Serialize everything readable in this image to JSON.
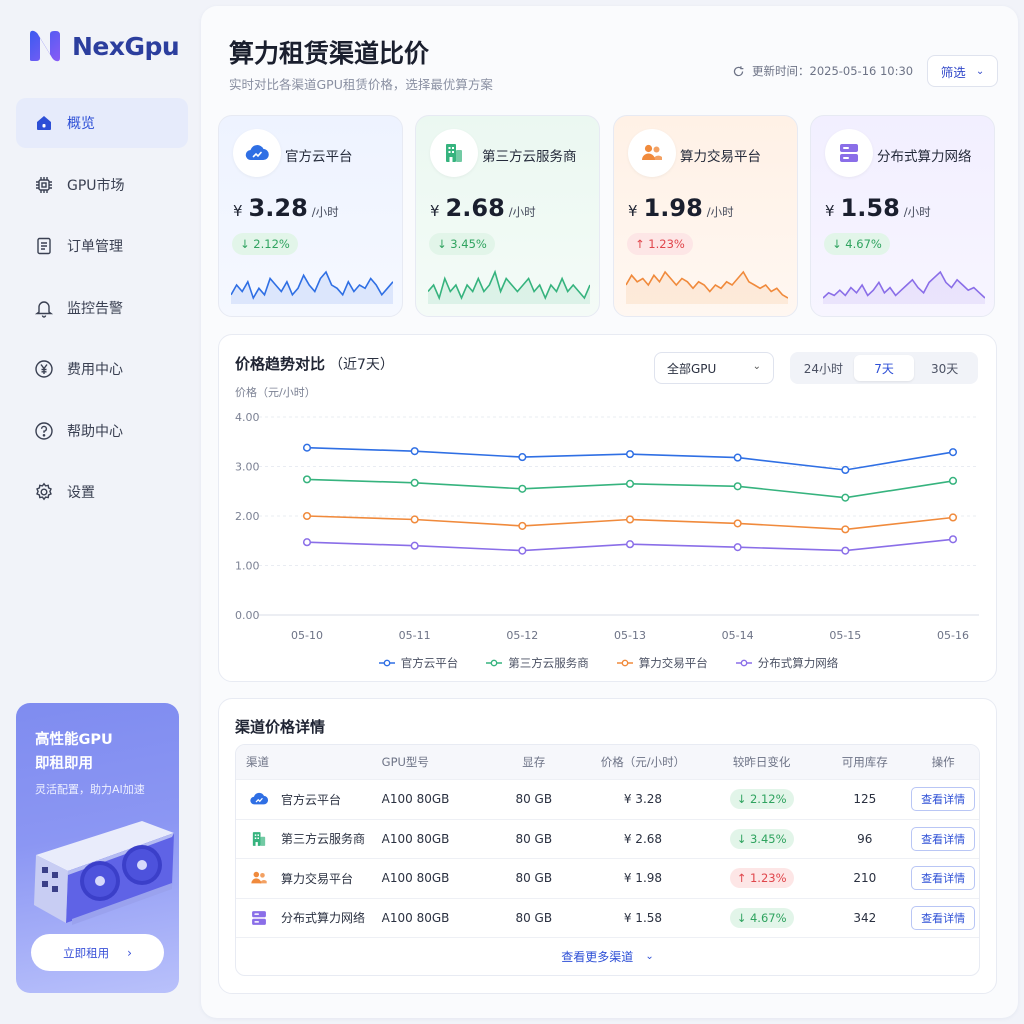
{
  "app": {
    "name": "NexGpu"
  },
  "nav": [
    {
      "label": "概览",
      "icon": "home-icon",
      "active": true
    },
    {
      "label": "GPU市场",
      "icon": "chip-icon"
    },
    {
      "label": "订单管理",
      "icon": "document-icon"
    },
    {
      "label": "监控告警",
      "icon": "bell-icon"
    },
    {
      "label": "费用中心",
      "icon": "yen-icon"
    },
    {
      "label": "帮助中心",
      "icon": "help-icon"
    },
    {
      "label": "设置",
      "icon": "gear-icon"
    }
  ],
  "promo": {
    "title_line1": "高性能GPU",
    "title_line2": "即租即用",
    "subtitle": "灵活配置，助力AI加速",
    "button": "立即租用"
  },
  "header": {
    "title": "算力租赁渠道比价",
    "subtitle": "实时对比各渠道GPU租赁价格，选择最优算方案",
    "update": "更新时间：2025-05-16 10:30",
    "filter": "筛选"
  },
  "cards": [
    {
      "name": "官方云平台",
      "currency": "¥",
      "price": "3.28",
      "unit": "/小时",
      "change": "↓ 2.12%",
      "dir": "down",
      "color": "#2f6fe4",
      "icon": "cloud-icon",
      "spark": [
        9,
        12,
        10,
        13,
        8,
        11,
        9,
        14,
        12,
        10,
        13,
        9,
        11,
        15,
        12,
        10,
        14,
        16,
        12,
        11,
        9,
        13,
        10,
        12,
        11,
        14,
        12,
        9,
        11,
        13
      ]
    },
    {
      "name": "第三方云服务商",
      "currency": "¥",
      "price": "2.68",
      "unit": "/小时",
      "change": "↓ 3.45%",
      "dir": "down",
      "color": "#36b37e",
      "icon": "building-icon",
      "spark": [
        11,
        12,
        10,
        13,
        11,
        12,
        10,
        12,
        11,
        13,
        11,
        12,
        14,
        11,
        13,
        12,
        11,
        12,
        13,
        11,
        12,
        10,
        12,
        11,
        13,
        11,
        12,
        11,
        10,
        12
      ]
    },
    {
      "name": "算力交易平台",
      "currency": "¥",
      "price": "1.98",
      "unit": "/小时",
      "change": "↑ 1.23%",
      "dir": "up",
      "color": "#f08a3c",
      "icon": "users-icon",
      "spark": [
        12,
        15,
        13,
        14,
        12,
        15,
        13,
        16,
        14,
        12,
        14,
        13,
        11,
        13,
        12,
        10,
        12,
        11,
        13,
        12,
        14,
        16,
        13,
        12,
        11,
        12,
        10,
        11,
        9,
        8
      ]
    },
    {
      "name": "分布式算力网络",
      "currency": "¥",
      "price": "1.58",
      "unit": "/小时",
      "change": "↓ 4.67%",
      "dir": "down",
      "color": "#8a6ee8",
      "icon": "server-icon",
      "spark": [
        8,
        10,
        9,
        11,
        9,
        12,
        10,
        13,
        9,
        11,
        14,
        10,
        12,
        9,
        11,
        13,
        15,
        12,
        10,
        14,
        16,
        18,
        14,
        12,
        15,
        13,
        11,
        12,
        10,
        8
      ]
    }
  ],
  "trend": {
    "title": "价格趋势对比",
    "range": "（近7天）",
    "gpu_select": "全部GPU",
    "tabs": [
      "24小时",
      "7天",
      "30天"
    ],
    "active_tab": 1,
    "ylabel": "价格（元/小时）"
  },
  "chart_data": {
    "type": "line",
    "x": [
      "05-10",
      "05-11",
      "05-12",
      "05-13",
      "05-14",
      "05-15",
      "05-16"
    ],
    "ylim": [
      0,
      4
    ],
    "yticks": [
      "0.00",
      "1.00",
      "2.00",
      "3.00",
      "4.00"
    ],
    "ylabel": "价格（元/小时）",
    "grid": true,
    "legend": "bottom",
    "series": [
      {
        "name": "官方云平台",
        "color": "#2f6fe4",
        "values": [
          3.38,
          3.31,
          3.19,
          3.25,
          3.18,
          2.93,
          3.29
        ]
      },
      {
        "name": "第三方云服务商",
        "color": "#36b37e",
        "values": [
          2.74,
          2.67,
          2.55,
          2.65,
          2.6,
          2.37,
          2.71
        ]
      },
      {
        "name": "算力交易平台",
        "color": "#f08a3c",
        "values": [
          2.0,
          1.93,
          1.8,
          1.93,
          1.85,
          1.73,
          1.97
        ]
      },
      {
        "name": "分布式算力网络",
        "color": "#8a6ee8",
        "values": [
          1.47,
          1.4,
          1.3,
          1.43,
          1.37,
          1.3,
          1.53
        ]
      }
    ]
  },
  "table": {
    "title": "渠道价格详情",
    "headers": [
      "渠道",
      "GPU型号",
      "显存",
      "价格（元/小时）",
      "较昨日变化",
      "可用库存",
      "操作"
    ],
    "rows": [
      {
        "channel": "官方云平台",
        "icon": "cloud-icon",
        "color": "#2f6fe4",
        "gpu": "A100 80GB",
        "mem": "80 GB",
        "price": "¥ 3.28",
        "change": "↓ 2.12%",
        "dir": "down",
        "stock": "125",
        "action": "查看详情"
      },
      {
        "channel": "第三方云服务商",
        "icon": "building-icon",
        "color": "#36b37e",
        "gpu": "A100 80GB",
        "mem": "80 GB",
        "price": "¥ 2.68",
        "change": "↓ 3.45%",
        "dir": "down",
        "stock": "96",
        "action": "查看详情"
      },
      {
        "channel": "算力交易平台",
        "icon": "users-icon",
        "color": "#f08a3c",
        "gpu": "A100 80GB",
        "mem": "80 GB",
        "price": "¥ 1.98",
        "change": "↑ 1.23%",
        "dir": "up",
        "stock": "210",
        "action": "查看详情"
      },
      {
        "channel": "分布式算力网络",
        "icon": "server-icon",
        "color": "#8a6ee8",
        "gpu": "A100 80GB",
        "mem": "80 GB",
        "price": "¥ 1.58",
        "change": "↓ 4.67%",
        "dir": "down",
        "stock": "342",
        "action": "查看详情"
      }
    ],
    "more": "查看更多渠道"
  }
}
